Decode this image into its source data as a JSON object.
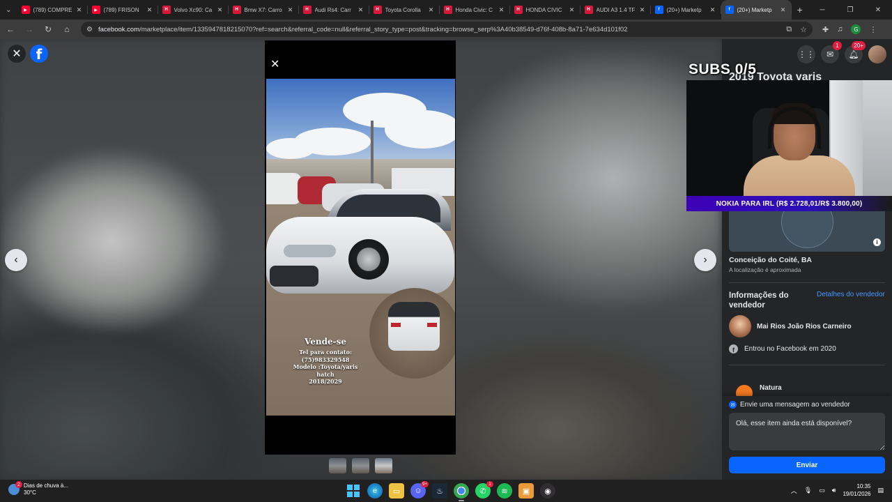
{
  "browser": {
    "tabs": [
      {
        "title": "(789) COMPRE",
        "favicon": "youtube-icon",
        "color": "#ff0033"
      },
      {
        "title": "(789) FRISON",
        "favicon": "youtube-icon",
        "color": "#ff0033"
      },
      {
        "title": "Volvo Xc90: Ca",
        "favicon": "hh-icon",
        "color": "#d6183a"
      },
      {
        "title": "Bmw X7: Carro",
        "favicon": "hh-icon",
        "color": "#d6183a"
      },
      {
        "title": "Audi Rs4: Carr",
        "favicon": "hh-icon",
        "color": "#d6183a"
      },
      {
        "title": "Toyota Corolla",
        "favicon": "hh-icon",
        "color": "#d6183a"
      },
      {
        "title": "Honda Civic: C",
        "favicon": "hh-icon",
        "color": "#d6183a"
      },
      {
        "title": "HONDA CIVIC",
        "favicon": "hh-icon",
        "color": "#d6183a"
      },
      {
        "title": "AUDI A3 1.4 TF",
        "favicon": "hh-icon",
        "color": "#d6183a"
      },
      {
        "title": "(20+) Marketp",
        "favicon": "facebook-icon",
        "color": "#0866ff"
      },
      {
        "title": "(20+) Marketp",
        "favicon": "facebook-icon",
        "color": "#0866ff"
      }
    ],
    "url_host": "facebook.com",
    "url_path": "/marketplace/item/1335947818215070?ref=search&referral_code=null&referral_story_type=post&tracking=browse_serp%3A40b38549-d76f-408b-8a71-7e634d101f02",
    "profile_initial": "G"
  },
  "photo": {
    "headline": "Vende-se",
    "lines": [
      "Tel para contato:",
      "(75)983329548",
      "Modelo :Toyota/yaris",
      "hatch",
      "2018/2029"
    ]
  },
  "panel": {
    "messenger_badge": "1",
    "notifications_badge": "20+",
    "listing_title": "2019 Toyota yaris",
    "location_city": "Conceição do Coité, BA",
    "location_note": "A localização é aproximada",
    "seller_heading": "Informações do vendedor",
    "seller_details_link": "Detalhes do vendedor",
    "seller_name": "Mai Rios João Rios Carneiro",
    "joined": "Entrou no Facebook em 2020",
    "badge_name": "Natura",
    "message_heading": "Envie uma mensagem ao vendedor",
    "message_text": "Olá, esse item ainda está disponível?",
    "send_label": "Enviar"
  },
  "overlay": {
    "subs_label": "SUBS",
    "subs_count": "0/5",
    "ticker": "NOKIA PARA IRL (R$ 2.728,01/R$ 3.800,00)"
  },
  "taskbar": {
    "weather_title": "Dias de chuva à...",
    "weather_temp": "30°C",
    "weather_badge": "2",
    "time": "10:35",
    "date": "19/01/2026",
    "discord_badge": "9+",
    "whatsapp_badge": "1"
  }
}
